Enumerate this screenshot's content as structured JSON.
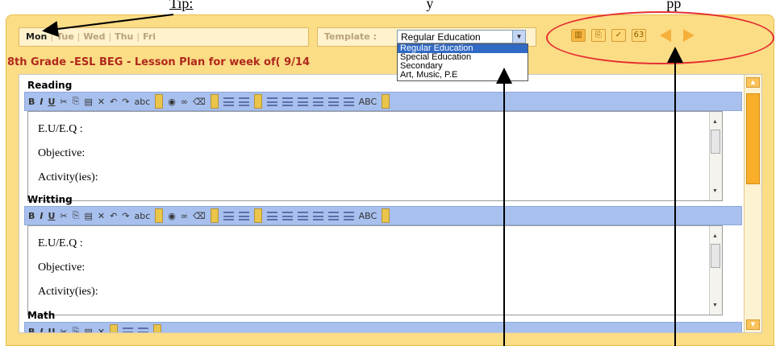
{
  "caption": {
    "left_word": "Tip:",
    "middle_text": "y",
    "right_text": "pp"
  },
  "days": {
    "items": [
      "Mon",
      "Tue",
      "Wed",
      "Thu",
      "Fri"
    ],
    "active": "Mon"
  },
  "template": {
    "label": "Template :",
    "selected": "Regular Education",
    "options": [
      "Regular Education",
      "Special Education",
      "Secondary",
      "Art, Music, P.E"
    ]
  },
  "icons": [
    "book-icon",
    "copy-icon",
    "check-icon",
    "spell-icon",
    "prev-arrow-icon",
    "next-arrow-icon"
  ],
  "heading": "8th Grade -ESL BEG - Lesson Plan for week of( 9/14",
  "sections": [
    {
      "title": "Reading",
      "lines": [
        "E.U/E.Q :",
        "Objective:",
        "Activity(ies):"
      ]
    },
    {
      "title": "Writting",
      "lines": [
        "E.U/E.Q :",
        "Objective:",
        "Activity(ies):"
      ]
    },
    {
      "title": "Math",
      "lines": []
    }
  ],
  "toolbar": {
    "bold": "B",
    "italic": "I",
    "underline": "U",
    "strike": "abc",
    "spell": "ABC"
  },
  "colors": {
    "panel": "#fbdd86",
    "accent": "#f5b03a",
    "heading": "#b0281c",
    "toolbar": "#a8c0ee",
    "ellipse": "#e53030"
  }
}
